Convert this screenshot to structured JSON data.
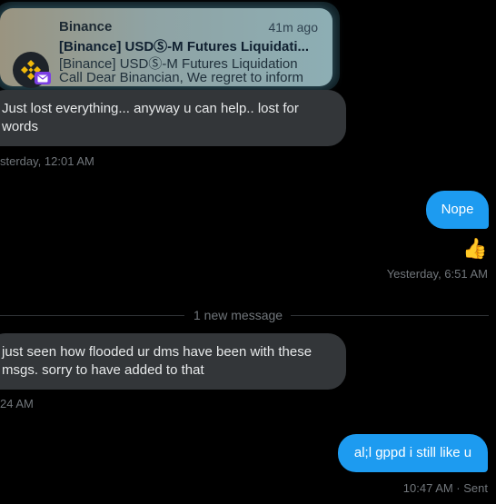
{
  "notification": {
    "app": "Binance",
    "time": "41m ago",
    "title": "[Binance] USDⓈ-M Futures Liquidati...",
    "body_line1": "[Binance] USDⓈ-M Futures Liquidation",
    "body_line2": "Call Dear Binancian, We regret to inform"
  },
  "messages": [
    {
      "direction": "in",
      "text": "Just lost everything... anyway u can help.. lost for words",
      "meta": "sterday, 12:01 AM"
    },
    {
      "direction": "out",
      "text": "Nope",
      "reaction": "👍",
      "meta": "Yesterday, 6:51 AM"
    },
    {
      "direction": "divider",
      "text": "1 new message"
    },
    {
      "direction": "in",
      "text": "just seen how flooded ur dms have been with these msgs. sorry to have added to that",
      "meta": "24 AM"
    },
    {
      "direction": "out",
      "text": "al;l gppd i still like u",
      "meta": "10:47 AM · Sent"
    }
  ],
  "colors": {
    "background": "#000000",
    "incoming_bubble": "#333639",
    "outgoing_bubble": "#1d9bf0",
    "meta_text": "#71767b",
    "binance_gold": "#f0b90b"
  }
}
